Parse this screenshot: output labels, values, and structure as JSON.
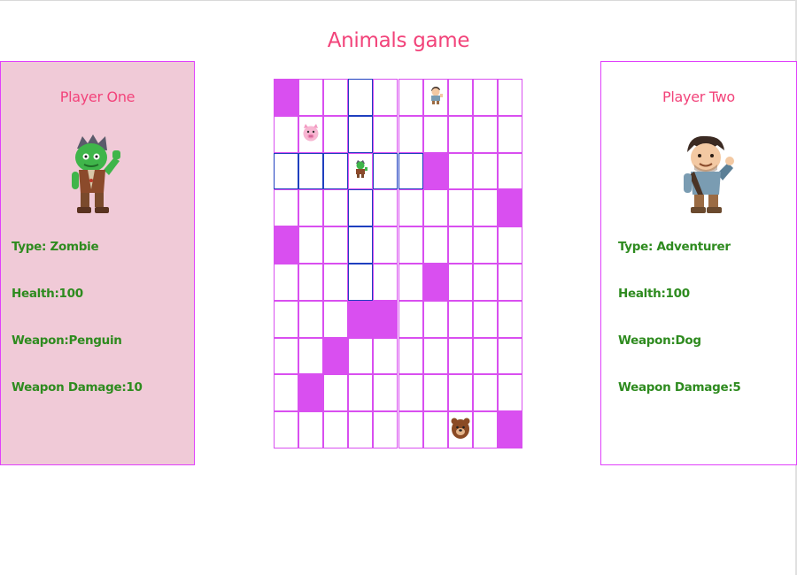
{
  "title": "Animals game",
  "players": {
    "one": {
      "name": "Player One",
      "type": "Type: Zombie",
      "health": "Health:100",
      "weapon": "Weapon:Penguin",
      "damage": "Weapon Damage:10",
      "avatar": "zombie-icon",
      "active": true,
      "panel_color": "#f0cad7"
    },
    "two": {
      "name": "Player Two",
      "type": "Type: Adventurer",
      "health": "Health:100",
      "weapon": "Weapon:Dog",
      "damage": "Weapon Damage:5",
      "avatar": "adventurer-icon",
      "active": false,
      "panel_color": "#ffffff"
    }
  },
  "board": {
    "cols": 10,
    "rows": 10,
    "walls": [
      [
        0,
        0
      ],
      [
        2,
        6
      ],
      [
        3,
        9
      ],
      [
        4,
        0
      ],
      [
        5,
        6
      ],
      [
        6,
        3
      ],
      [
        6,
        4
      ],
      [
        7,
        2
      ],
      [
        8,
        1
      ],
      [
        9,
        9
      ]
    ],
    "moves": [
      [
        0,
        3
      ],
      [
        1,
        3
      ],
      [
        2,
        0
      ],
      [
        2,
        1
      ],
      [
        2,
        2
      ],
      [
        2,
        4
      ],
      [
        2,
        5
      ],
      [
        3,
        3
      ],
      [
        4,
        3
      ],
      [
        5,
        3
      ]
    ],
    "pieces": [
      {
        "row": 0,
        "col": 6,
        "kind": "adventurer-icon"
      },
      {
        "row": 1,
        "col": 1,
        "kind": "pig-icon"
      },
      {
        "row": 2,
        "col": 3,
        "kind": "zombie-icon"
      },
      {
        "row": 9,
        "col": 7,
        "kind": "bear-icon"
      }
    ]
  },
  "colors": {
    "accent": "#f2437a",
    "wall": "#d94ff0",
    "move_border": "#1f3fbf",
    "stat_text": "#2e8b1f"
  }
}
